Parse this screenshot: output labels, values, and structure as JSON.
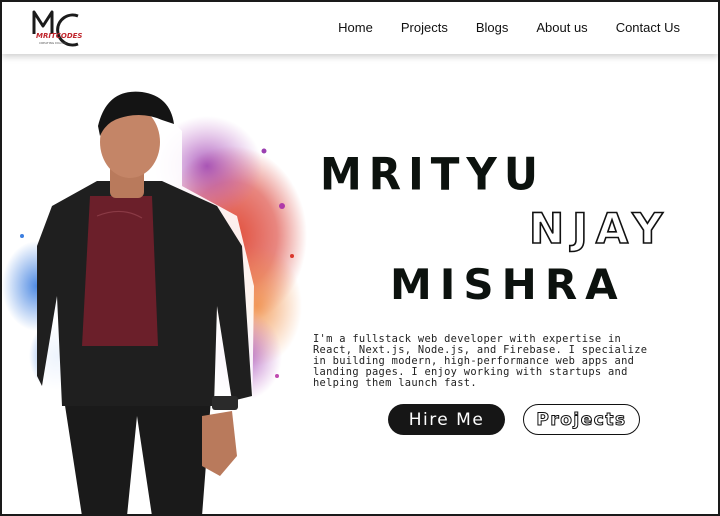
{
  "brand": {
    "logo_text": "MRITCODES",
    "logo_subtext": "CREATING DIGITAL",
    "logo_monogram": "MC"
  },
  "nav": {
    "items": [
      {
        "label": "Home"
      },
      {
        "label": "Projects"
      },
      {
        "label": "Blogs"
      },
      {
        "label": "About us"
      },
      {
        "label": "Contact Us"
      }
    ]
  },
  "hero": {
    "name_line_1": "MRITYU",
    "name_line_2": "NJAY",
    "name_line_3": "MISHRA",
    "bio": "I'm a fullstack web developer with expertise in React, Next.js, Node.js, and Firebase. I specialize in building modern, high-performance web apps and landing pages. I enjoy working with startups and helping them launch fast.",
    "hire_button": "Hire Me",
    "projects_button": "Projects",
    "photo_icon": "person-portrait-photo"
  },
  "colors": {
    "dark": "#161616",
    "splash_red": "#d9362b",
    "splash_blue": "#3c7ee0",
    "splash_purple": "#9b3fb0"
  }
}
